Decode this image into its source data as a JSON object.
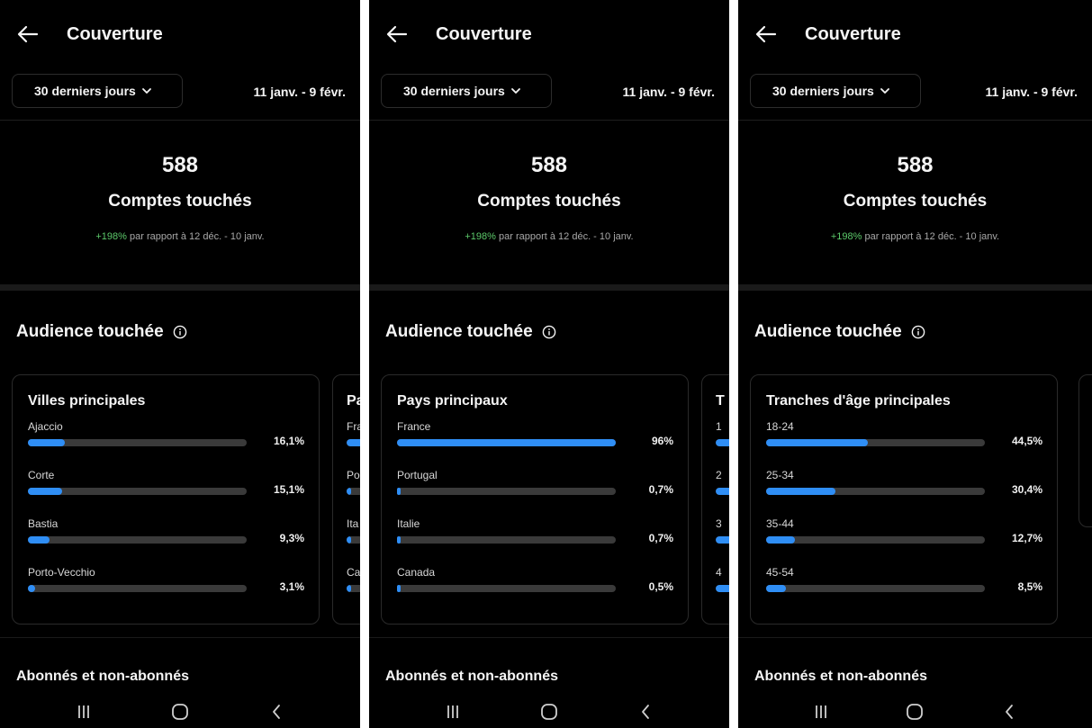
{
  "panels": [
    {
      "header": {
        "title": "Couverture"
      },
      "period": {
        "label": "30 derniers jours",
        "range": "11 janv. - 9 févr."
      },
      "summary": {
        "value": "588",
        "label": "Comptes touchés",
        "change": "+198%",
        "compare": "par rapport à 12 déc. - 10 janv."
      },
      "audience": {
        "title": "Audience touchée"
      },
      "card": {
        "title": "Villes principales",
        "rows": [
          {
            "label": "Ajaccio",
            "pct": "16,1%",
            "value": 0.161
          },
          {
            "label": "Corte",
            "pct": "15,1%",
            "value": 0.151
          },
          {
            "label": "Bastia",
            "pct": "9,3%",
            "value": 0.093
          },
          {
            "label": "Porto-Vecchio",
            "pct": "3,1%",
            "value": 0.031
          }
        ]
      },
      "peek": {
        "title": "Pa",
        "rows": [
          {
            "label": "Fra",
            "value": 0.96
          },
          {
            "label": "Po",
            "value": 0.007
          },
          {
            "label": "Ita",
            "value": 0.007
          },
          {
            "label": "Ca",
            "value": 0.005
          }
        ]
      },
      "next_section": "Abonnés et non-abonnés"
    },
    {
      "header": {
        "title": "Couverture"
      },
      "period": {
        "label": "30 derniers jours",
        "range": "11 janv. - 9 févr."
      },
      "summary": {
        "value": "588",
        "label": "Comptes touchés",
        "change": "+198%",
        "compare": "par rapport à 12 déc. - 10 janv."
      },
      "audience": {
        "title": "Audience touchée"
      },
      "card": {
        "title": "Pays principaux",
        "rows": [
          {
            "label": "France",
            "pct": "96%",
            "value": 0.96
          },
          {
            "label": "Portugal",
            "pct": "0,7%",
            "value": 0.007
          },
          {
            "label": "Italie",
            "pct": "0,7%",
            "value": 0.007
          },
          {
            "label": "Canada",
            "pct": "0,5%",
            "value": 0.005
          }
        ]
      },
      "peek": {
        "title": "T",
        "rows": [
          {
            "label": "1",
            "value": 0.445
          },
          {
            "label": "2",
            "value": 0.304
          },
          {
            "label": "3",
            "value": 0.127
          },
          {
            "label": "4",
            "value": 0.085
          }
        ]
      },
      "next_section": "Abonnés et non-abonnés"
    },
    {
      "header": {
        "title": "Couverture"
      },
      "period": {
        "label": "30 derniers jours",
        "range": "11 janv. - 9 févr."
      },
      "summary": {
        "value": "588",
        "label": "Comptes touchés",
        "change": "+198%",
        "compare": "par rapport à 12 déc. - 10 janv."
      },
      "audience": {
        "title": "Audience touchée"
      },
      "card": {
        "title": "Tranches d'âge principales",
        "rows": [
          {
            "label": "18-24",
            "pct": "44,5%",
            "value": 0.445
          },
          {
            "label": "25-34",
            "pct": "30,4%",
            "value": 0.304
          },
          {
            "label": "35-44",
            "pct": "12,7%",
            "value": 0.127
          },
          {
            "label": "45-54",
            "pct": "8,5%",
            "value": 0.085
          }
        ]
      },
      "peek": {
        "title": "",
        "rows": []
      },
      "next_section": "Abonnés et non-abonnés"
    }
  ],
  "colors": {
    "accent": "#2f8ef5",
    "positive": "#5cc96a",
    "track": "#3a3a3a",
    "background": "#000000"
  },
  "icons": {
    "back": "arrow-left-icon",
    "dropdown": "chevron-down-icon",
    "info": "info-circle-icon",
    "nav": [
      "recent-apps-icon",
      "home-icon",
      "back-chevron-icon"
    ]
  }
}
